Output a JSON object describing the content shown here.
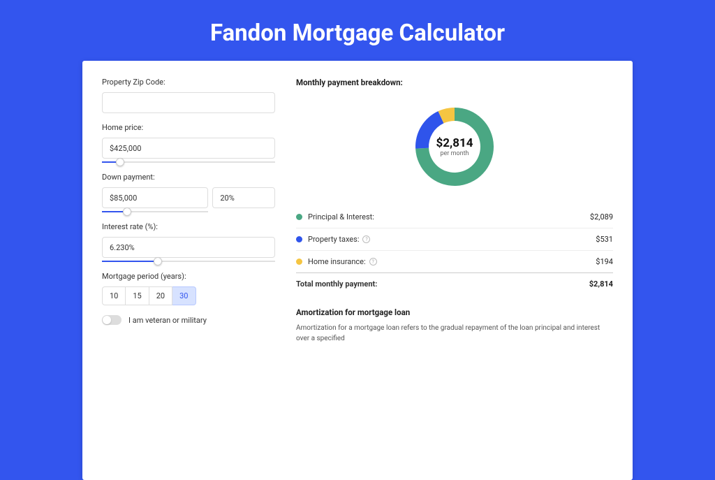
{
  "page": {
    "title": "Fandon Mortgage Calculator"
  },
  "form": {
    "zip": {
      "label": "Property Zip Code:",
      "value": ""
    },
    "price": {
      "label": "Home price:",
      "value": "$425,000",
      "slider_pct": 8
    },
    "down": {
      "label": "Down payment:",
      "amount": "$85,000",
      "pct": "20%",
      "slider_pct": 20
    },
    "rate": {
      "label": "Interest rate (%):",
      "value": "6.230%",
      "slider_pct": 30
    },
    "period": {
      "label": "Mortgage period (years):",
      "options": [
        "10",
        "15",
        "20",
        "30"
      ],
      "active": "30"
    },
    "veteran": {
      "label": "I am veteran or military",
      "on": false
    }
  },
  "breakdown": {
    "title": "Monthly payment breakdown:",
    "center_value": "$2,814",
    "center_sub": "per month",
    "items": [
      {
        "color": "#4aa783",
        "label": "Principal & Interest:",
        "value": "$2,089",
        "info": false
      },
      {
        "color": "#2f54eb",
        "label": "Property taxes:",
        "value": "$531",
        "info": true
      },
      {
        "color": "#f5c542",
        "label": "Home insurance:",
        "value": "$194",
        "info": true
      }
    ],
    "total_label": "Total monthly payment:",
    "total_value": "$2,814"
  },
  "amort": {
    "title": "Amortization for mortgage loan",
    "text": "Amortization for a mortgage loan refers to the gradual repayment of the loan principal and interest over a specified"
  },
  "chart_data": {
    "type": "pie",
    "title": "Monthly payment breakdown",
    "series": [
      {
        "name": "Principal & Interest",
        "value": 2089,
        "color": "#4aa783"
      },
      {
        "name": "Property taxes",
        "value": 531,
        "color": "#2f54eb"
      },
      {
        "name": "Home insurance",
        "value": 194,
        "color": "#f5c542"
      }
    ],
    "total": 2814,
    "center_label": "$2,814 per month",
    "donut": true
  }
}
